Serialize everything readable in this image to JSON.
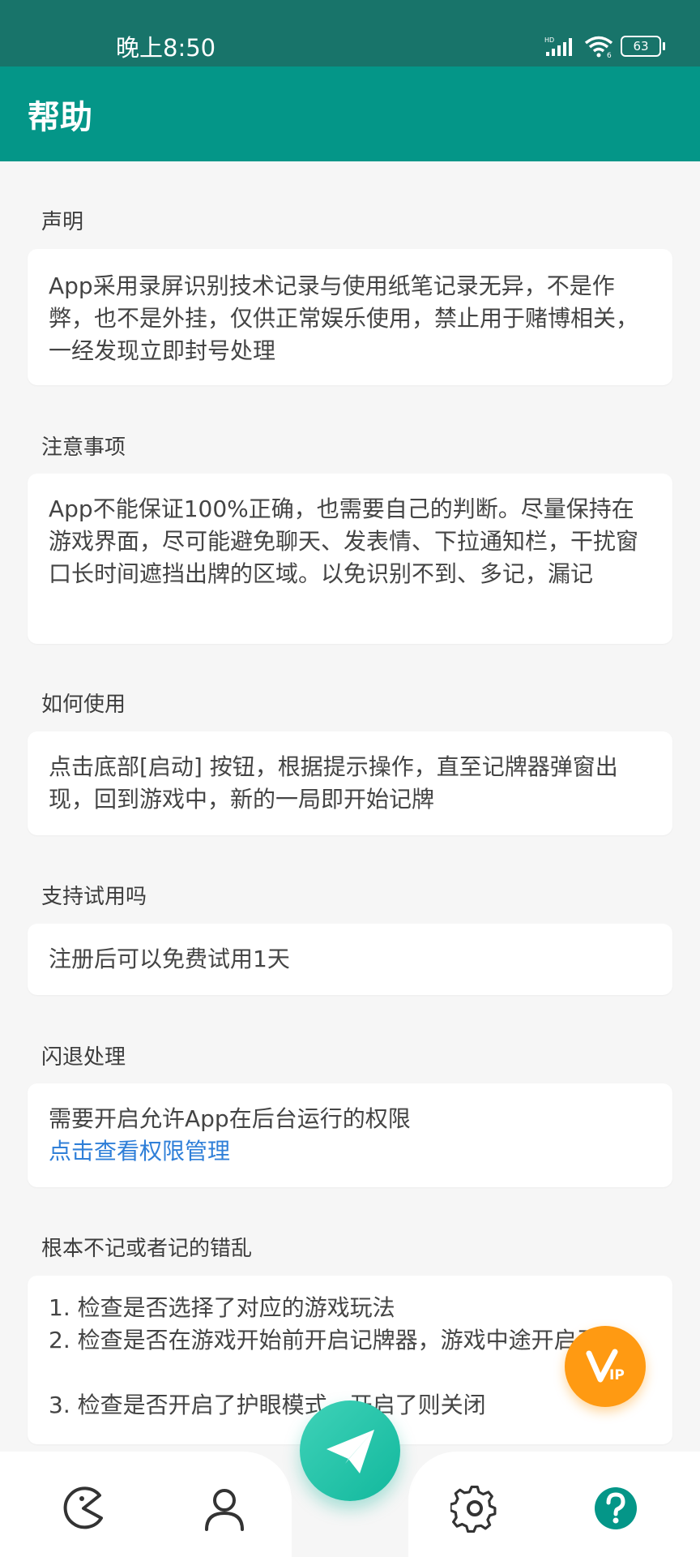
{
  "status_bar": {
    "time": "晚上8:50",
    "battery": "63"
  },
  "app_bar": {
    "title": "帮助"
  },
  "sections": [
    {
      "title": "声明",
      "text": "App采用录屏识别技术记录与使用纸笔记录无异，不是作弊，也不是外挂，仅供正常娱乐使用，禁止用于赌博相关，一经发现立即封号处理"
    },
    {
      "title": "注意事项",
      "text": "App不能保证100%正确，也需要自己的判断。尽量保持在游戏界面，尽可能避免聊天、发表情、下拉通知栏，干扰窗口长时间遮挡出牌的区域。以免识别不到、多记，漏记"
    },
    {
      "title": "如何使用",
      "text": "点击底部[启动] 按钮，根据提示操作，直至记牌器弹窗出现，回到游戏中，新的一局即开始记牌"
    },
    {
      "title": "支持试用吗",
      "text": "注册后可以免费试用1天"
    },
    {
      "title": "闪退处理",
      "text": "需要开启允许App在后台运行的权限",
      "link": "点击查看权限管理"
    },
    {
      "title": "根本不记或者记的错乱",
      "items": [
        "1. 检查是否选择了对应的游戏玩法",
        "2. 检查是否在游戏开始前开启记牌器，游戏中途开启无效",
        "3. 检查是否开启了护眼模式，开启了则关闭"
      ]
    }
  ],
  "bottom_nav": {
    "items": [
      {
        "icon": "pacman-icon"
      },
      {
        "icon": "user-icon"
      },
      {
        "icon": "gear-icon"
      },
      {
        "icon": "help-icon"
      }
    ],
    "center_icon": "send-icon",
    "vip_icon": "vip-icon"
  },
  "colors": {
    "primary": "#049688",
    "status_bar": "#18746a",
    "accent": "#ff9a12",
    "link": "#2f7fd8"
  }
}
